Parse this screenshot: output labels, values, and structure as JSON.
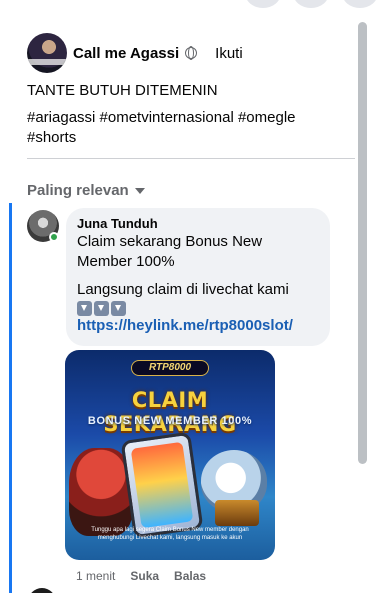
{
  "post": {
    "author": "Call me Agassi",
    "follow_label": "Ikuti",
    "text_line1": "TANTE BUTUH DITEMENIN",
    "hashtags": "#ariagassi #ometvinternasional #omegle #shorts"
  },
  "comments_sort": {
    "label": "Paling relevan"
  },
  "comment": {
    "author": "Juna Tunduh",
    "line1": "Claim sekarang Bonus New Member 100%",
    "line2": "Langsung claim di livechat kami",
    "link": "https://heylink.me/rtp8000slot/",
    "image": {
      "logo_text": "RTP8000",
      "title": "CLAIM SEKARANG",
      "subtitle": "BONUS NEW MEMBER 100%",
      "caption": "Tunggu apa lagi segera Claim Bonus New member dengan menghubungi Livechat kami, langsung masuk ke akun"
    },
    "time": "1 menit",
    "like_label": "Suka",
    "reply_label": "Balas"
  },
  "colors": {
    "link": "#1a5fb4",
    "online": "#31a24c",
    "highlight": "#1877f2",
    "promo_title": "#f7d23e"
  }
}
